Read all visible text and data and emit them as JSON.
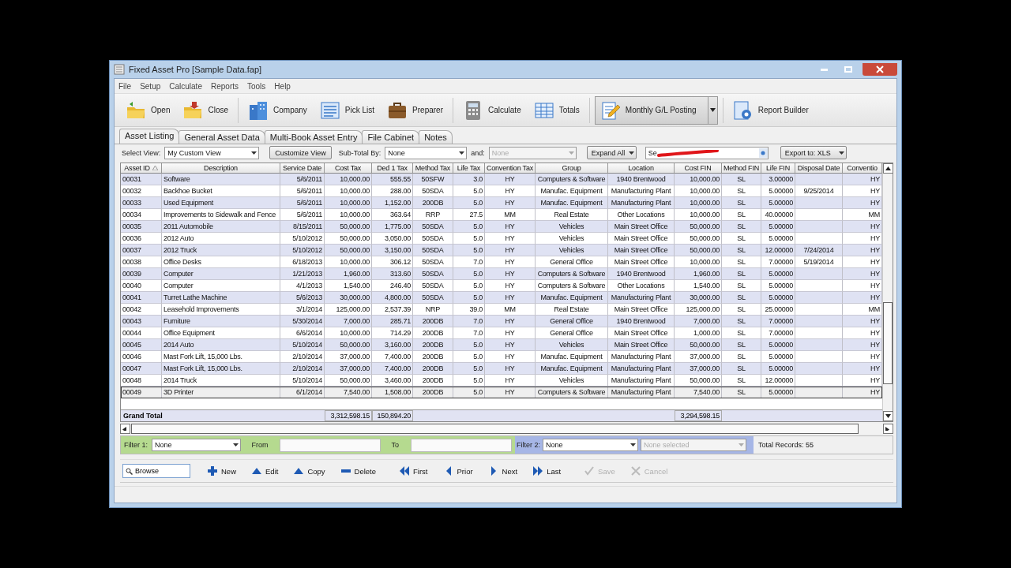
{
  "window": {
    "title": "Fixed Asset Pro [Sample Data.fap]"
  },
  "menu": [
    "File",
    "Setup",
    "Calculate",
    "Reports",
    "Tools",
    "Help"
  ],
  "toolbar": [
    {
      "label": "Open",
      "kind": "button"
    },
    {
      "label": "Close",
      "kind": "button"
    },
    {
      "label": "Company",
      "kind": "button"
    },
    {
      "label": "Pick List",
      "kind": "button"
    },
    {
      "label": "Preparer",
      "kind": "button"
    },
    {
      "label": "Calculate",
      "kind": "button"
    },
    {
      "label": "Totals",
      "kind": "button"
    },
    {
      "label": "Monthly G/L Posting",
      "kind": "split"
    },
    {
      "label": "Report Builder",
      "kind": "button"
    }
  ],
  "tabs": [
    {
      "label": "Asset Listing",
      "selected": true
    },
    {
      "label": "General Asset Data",
      "selected": false
    },
    {
      "label": "Multi-Book Asset Entry",
      "selected": false
    },
    {
      "label": "File Cabinet",
      "selected": false
    },
    {
      "label": "Notes",
      "selected": false
    }
  ],
  "view_bar": {
    "select_view_label": "Select View:",
    "select_view": "My Custom View",
    "customize_button": "Customize View",
    "subtotal_label": "Sub-Total By:",
    "subtotal": "None",
    "and_label": "and:",
    "and_value": {
      "value": "None",
      "disabled": true
    },
    "expand_button": "Expand All",
    "search_label": "Se",
    "export_button": "Export to: XLS"
  },
  "table": {
    "columns": [
      {
        "label": "Asset ID",
        "sorted": true
      },
      {
        "label": "Description",
        "sorted": false
      },
      {
        "label": "Service Date",
        "sorted": false
      },
      {
        "label": "Cost Tax",
        "sorted": false
      },
      {
        "label": "Ded 1 Tax",
        "sorted": false
      },
      {
        "label": "Method Tax",
        "sorted": false
      },
      {
        "label": "Life Tax",
        "sorted": false
      },
      {
        "label": "Convention Tax",
        "sorted": false
      },
      {
        "label": "Group",
        "sorted": false
      },
      {
        "label": "Location",
        "sorted": false
      },
      {
        "label": "Cost FIN",
        "sorted": false
      },
      {
        "label": "Method FIN",
        "sorted": false
      },
      {
        "label": "Life FIN",
        "sorted": false
      },
      {
        "label": "Disposal Date",
        "sorted": false
      },
      {
        "label": "Conventio",
        "sorted": false
      }
    ],
    "rows": [
      {
        "asset_id": "00031",
        "description": "Software",
        "service_date": "5/6/2011",
        "cost_tax": "10,000.00",
        "ded_1_tax": "555.55",
        "method_tax": "50SFW",
        "life_tax": "3.0",
        "convention_tax": "HY",
        "group": "Computers & Software",
        "location": "1940 Brentwood",
        "cost_fin": "10,000.00",
        "method_fin": "SL",
        "life_fin": "3.00000",
        "convention": "HY",
        "selected": false
      },
      {
        "asset_id": "00032",
        "description": "Backhoe Bucket",
        "service_date": "5/6/2011",
        "cost_tax": "10,000.00",
        "ded_1_tax": "288.00",
        "method_tax": "50SDA",
        "life_tax": "5.0",
        "convention_tax": "HY",
        "group": "Manufac. Equipment",
        "location": "Manufacturing Plant",
        "cost_fin": "10,000.00",
        "method_fin": "SL",
        "life_fin": "5.00000",
        "disposal_date": "9/25/2014",
        "convention": "HY",
        "selected": false
      },
      {
        "asset_id": "00033",
        "description": "Used Equipment",
        "service_date": "5/6/2011",
        "cost_tax": "10,000.00",
        "ded_1_tax": "1,152.00",
        "method_tax": "200DB",
        "life_tax": "5.0",
        "convention_tax": "HY",
        "group": "Manufac. Equipment",
        "location": "Manufacturing Plant",
        "cost_fin": "10,000.00",
        "method_fin": "SL",
        "life_fin": "5.00000",
        "convention": "HY",
        "selected": false
      },
      {
        "asset_id": "00034",
        "description": "Improvements to Sidewalk and Fence",
        "service_date": "5/6/2011",
        "cost_tax": "10,000.00",
        "ded_1_tax": "363.64",
        "method_tax": "RRP",
        "life_tax": "27.5",
        "convention_tax": "MM",
        "group": "Real Estate",
        "location": "Other Locations",
        "cost_fin": "10,000.00",
        "method_fin": "SL",
        "life_fin": "40.00000",
        "convention": "MM",
        "selected": false
      },
      {
        "asset_id": "00035",
        "description": "2011 Automobile",
        "service_date": "8/15/2011",
        "cost_tax": "50,000.00",
        "ded_1_tax": "1,775.00",
        "method_tax": "50SDA",
        "life_tax": "5.0",
        "convention_tax": "HY",
        "group": "Vehicles",
        "location": "Main Street Office",
        "cost_fin": "50,000.00",
        "method_fin": "SL",
        "life_fin": "5.00000",
        "convention": "HY",
        "selected": false
      },
      {
        "asset_id": "00036",
        "description": "2012 Auto",
        "service_date": "5/10/2012",
        "cost_tax": "50,000.00",
        "ded_1_tax": "3,050.00",
        "method_tax": "50SDA",
        "life_tax": "5.0",
        "convention_tax": "HY",
        "group": "Vehicles",
        "location": "Main Street Office",
        "cost_fin": "50,000.00",
        "method_fin": "SL",
        "life_fin": "5.00000",
        "convention": "HY",
        "selected": false
      },
      {
        "asset_id": "00037",
        "description": "2012 Truck",
        "service_date": "5/10/2012",
        "cost_tax": "50,000.00",
        "ded_1_tax": "3,150.00",
        "method_tax": "50SDA",
        "life_tax": "5.0",
        "convention_tax": "HY",
        "group": "Vehicles",
        "location": "Main Street Office",
        "cost_fin": "50,000.00",
        "method_fin": "SL",
        "life_fin": "12.00000",
        "disposal_date": "7/24/2014",
        "convention": "HY",
        "selected": false
      },
      {
        "asset_id": "00038",
        "description": "Office Desks",
        "service_date": "6/18/2013",
        "cost_tax": "10,000.00",
        "ded_1_tax": "306.12",
        "method_tax": "50SDA",
        "life_tax": "7.0",
        "convention_tax": "HY",
        "group": "General Office",
        "location": "Main Street Office",
        "cost_fin": "10,000.00",
        "method_fin": "SL",
        "life_fin": "7.00000",
        "disposal_date": "5/19/2014",
        "convention": "HY",
        "selected": false
      },
      {
        "asset_id": "00039",
        "description": "Computer",
        "service_date": "1/21/2013",
        "cost_tax": "1,960.00",
        "ded_1_tax": "313.60",
        "method_tax": "50SDA",
        "life_tax": "5.0",
        "convention_tax": "HY",
        "group": "Computers & Software",
        "location": "1940 Brentwood",
        "cost_fin": "1,960.00",
        "method_fin": "SL",
        "life_fin": "5.00000",
        "convention": "HY",
        "selected": false
      },
      {
        "asset_id": "00040",
        "description": "Computer",
        "service_date": "4/1/2013",
        "cost_tax": "1,540.00",
        "ded_1_tax": "246.40",
        "method_tax": "50SDA",
        "life_tax": "5.0",
        "convention_tax": "HY",
        "group": "Computers & Software",
        "location": "Other Locations",
        "cost_fin": "1,540.00",
        "method_fin": "SL",
        "life_fin": "5.00000",
        "convention": "HY",
        "selected": false
      },
      {
        "asset_id": "00041",
        "description": "Turret Lathe Machine",
        "service_date": "5/6/2013",
        "cost_tax": "30,000.00",
        "ded_1_tax": "4,800.00",
        "method_tax": "50SDA",
        "life_tax": "5.0",
        "convention_tax": "HY",
        "group": "Manufac. Equipment",
        "location": "Manufacturing Plant",
        "cost_fin": "30,000.00",
        "method_fin": "SL",
        "life_fin": "5.00000",
        "convention": "HY",
        "selected": false
      },
      {
        "asset_id": "00042",
        "description": "Leasehold Improvements",
        "service_date": "3/1/2014",
        "cost_tax": "125,000.00",
        "ded_1_tax": "2,537.39",
        "method_tax": "NRP",
        "life_tax": "39.0",
        "convention_tax": "MM",
        "group": "Real Estate",
        "location": "Main Street Office",
        "cost_fin": "125,000.00",
        "method_fin": "SL",
        "life_fin": "25.00000",
        "convention": "MM",
        "selected": false
      },
      {
        "asset_id": "00043",
        "description": "Furniture",
        "service_date": "5/30/2014",
        "cost_tax": "7,000.00",
        "ded_1_tax": "285.71",
        "method_tax": "200DB",
        "life_tax": "7.0",
        "convention_tax": "HY",
        "group": "General Office",
        "location": "1940 Brentwood",
        "cost_fin": "7,000.00",
        "method_fin": "SL",
        "life_fin": "7.00000",
        "convention": "HY",
        "selected": false
      },
      {
        "asset_id": "00044",
        "description": "Office Equipment",
        "service_date": "6/6/2014",
        "cost_tax": "10,000.00",
        "ded_1_tax": "714.29",
        "method_tax": "200DB",
        "life_tax": "7.0",
        "convention_tax": "HY",
        "group": "General Office",
        "location": "Main Street Office",
        "cost_fin": "1,000.00",
        "method_fin": "SL",
        "life_fin": "7.00000",
        "convention": "HY",
        "selected": false
      },
      {
        "asset_id": "00045",
        "description": "2014 Auto",
        "service_date": "5/10/2014",
        "cost_tax": "50,000.00",
        "ded_1_tax": "3,160.00",
        "method_tax": "200DB",
        "life_tax": "5.0",
        "convention_tax": "HY",
        "group": "Vehicles",
        "location": "Main Street Office",
        "cost_fin": "50,000.00",
        "method_fin": "SL",
        "life_fin": "5.00000",
        "convention": "HY",
        "selected": false
      },
      {
        "asset_id": "00046",
        "description": "Mast Fork Lift, 15,000 Lbs.",
        "service_date": "2/10/2014",
        "cost_tax": "37,000.00",
        "ded_1_tax": "7,400.00",
        "method_tax": "200DB",
        "life_tax": "5.0",
        "convention_tax": "HY",
        "group": "Manufac. Equipment",
        "location": "Manufacturing Plant",
        "cost_fin": "37,000.00",
        "method_fin": "SL",
        "life_fin": "5.00000",
        "convention": "HY",
        "selected": false
      },
      {
        "asset_id": "00047",
        "description": "Mast Fork Lift, 15,000 Lbs.",
        "service_date": "2/10/2014",
        "cost_tax": "37,000.00",
        "ded_1_tax": "7,400.00",
        "method_tax": "200DB",
        "life_tax": "5.0",
        "convention_tax": "HY",
        "group": "Manufac. Equipment",
        "location": "Manufacturing Plant",
        "cost_fin": "37,000.00",
        "method_fin": "SL",
        "life_fin": "5.00000",
        "convention": "HY",
        "selected": false
      },
      {
        "asset_id": "00048",
        "description": "2014 Truck",
        "service_date": "5/10/2014",
        "cost_tax": "50,000.00",
        "ded_1_tax": "3,460.00",
        "method_tax": "200DB",
        "life_tax": "5.0",
        "convention_tax": "HY",
        "group": "Vehicles",
        "location": "Manufacturing Plant",
        "cost_fin": "50,000.00",
        "method_fin": "SL",
        "life_fin": "12.00000",
        "convention": "HY",
        "selected": false
      },
      {
        "asset_id": "00049",
        "description": "3D Printer",
        "service_date": "6/1/2014",
        "cost_tax": "7,540.00",
        "ded_1_tax": "1,508.00",
        "method_tax": "200DB",
        "life_tax": "5.0",
        "convention_tax": "HY",
        "group": "Computers & Software",
        "location": "Manufacturing Plant",
        "cost_fin": "7,540.00",
        "method_fin": "SL",
        "life_fin": "5.00000",
        "convention": "HY",
        "selected": true
      }
    ],
    "grand_total": {
      "label": "Grand Total",
      "cost_tax": "3,312,598.15",
      "ded_1_tax": "150,894.20",
      "cost_fin": "3,294,598.15"
    }
  },
  "filter_bar": {
    "filter_1_label": "Filter 1:",
    "filter_1": "None",
    "from_label": "From",
    "to_label": "To",
    "filter_2_label": "Filter 2:",
    "filter_2": "None",
    "filter_2_value": {
      "placeholder": "None selected",
      "disabled": true
    },
    "total_records": "Total Records: 55"
  },
  "nav_bar": {
    "browse": "Browse",
    "buttons": [
      {
        "label": "New",
        "disabled": false
      },
      {
        "label": "Edit",
        "disabled": false
      },
      {
        "label": "Copy",
        "disabled": false
      },
      {
        "label": "Delete",
        "disabled": false
      },
      {
        "label": "First",
        "disabled": false
      },
      {
        "label": "Prior",
        "disabled": false
      },
      {
        "label": "Next",
        "disabled": false
      },
      {
        "label": "Last",
        "disabled": false
      },
      {
        "label": "Save",
        "disabled": true
      },
      {
        "label": "Cancel",
        "disabled": true
      }
    ]
  }
}
